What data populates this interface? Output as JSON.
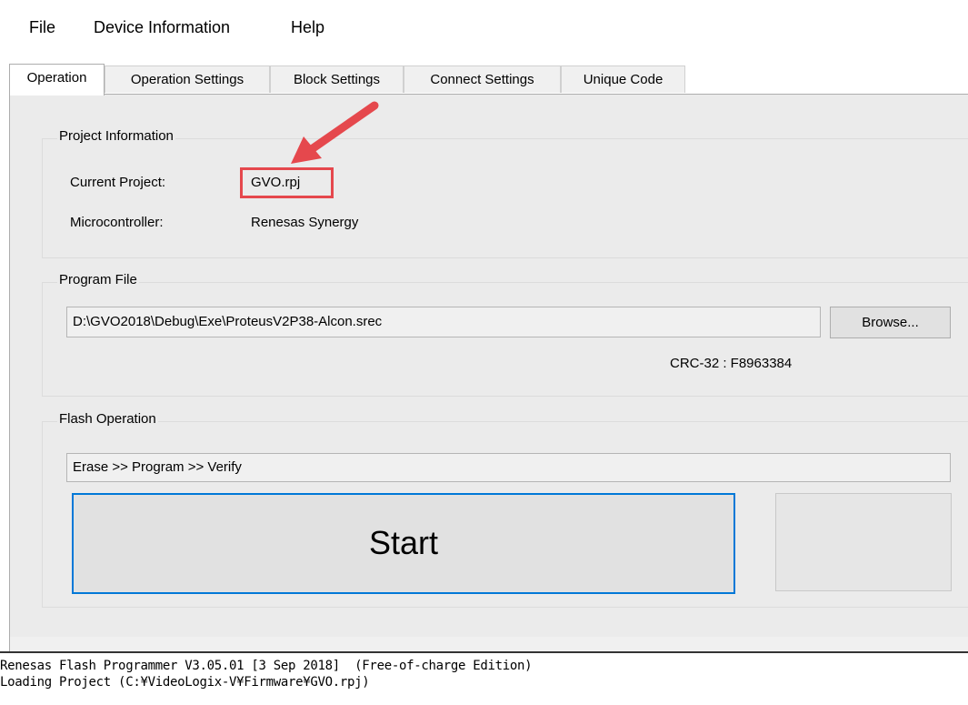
{
  "menu": {
    "file": "File",
    "device_information": "Device Information",
    "help": "Help"
  },
  "tabs": {
    "operation": "Operation",
    "operation_settings": "Operation Settings",
    "block_settings": "Block Settings",
    "connect_settings": "Connect Settings",
    "unique_code": "Unique Code",
    "active": "operation"
  },
  "project_info": {
    "title": "Project Information",
    "current_project_label": "Current Project:",
    "current_project_value": "GVO.rpj",
    "microcontroller_label": "Microcontroller:",
    "microcontroller_value": "Renesas Synergy"
  },
  "program_file": {
    "title": "Program File",
    "path": "D:\\GVO2018\\Debug\\Exe\\ProteusV2P38-Alcon.srec",
    "browse_label": "Browse...",
    "crc": "CRC-32 : F8963384"
  },
  "flash_operation": {
    "title": "Flash Operation",
    "sequence": "Erase >> Program >> Verify",
    "start_label": "Start"
  },
  "annotation": {
    "highlight_color": "#e5484d"
  },
  "log": {
    "line1": "Renesas Flash Programmer V3.05.01 [3 Sep 2018]  (Free-of-charge Edition)",
    "line2": "Loading Project (C:¥VideoLogix-V¥Firmware¥GVO.rpj)"
  }
}
